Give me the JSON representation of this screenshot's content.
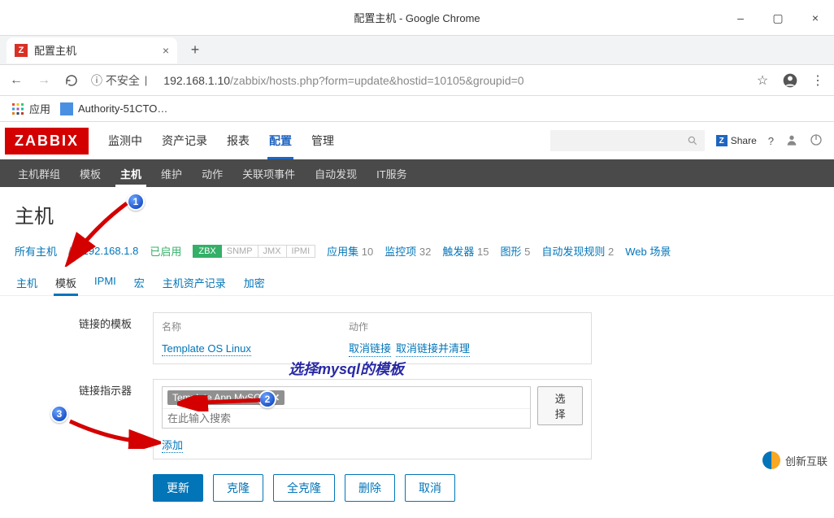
{
  "window": {
    "title": "配置主机 - Google Chrome",
    "controls": {
      "min": "–",
      "max": "▢",
      "close": "×"
    }
  },
  "tab": {
    "favicon_letter": "Z",
    "label": "配置主机",
    "close": "×",
    "new": "+"
  },
  "toolbar": {
    "back": "←",
    "forward": "→",
    "reload_icon": "reload",
    "insecure_prefix": "ⓘ 不安全",
    "sep": "|",
    "url_host": "192.168.1.10",
    "url_path": "/zabbix/hosts.php?form=update&hostid=10105&groupid=0",
    "star_icon": "☆",
    "profile_icon": "●",
    "menu_icon": "⋮"
  },
  "bookmarks": {
    "apps": "应用",
    "item1": "Authority-51CTO…"
  },
  "header": {
    "logo": "ZABBIX",
    "menu": [
      "监测中",
      "资产记录",
      "报表",
      "配置",
      "管理"
    ],
    "menu_active_index": 3,
    "share": "Share",
    "help": "?",
    "user_icon": "user",
    "power_icon": "power"
  },
  "submenu": {
    "items": [
      "主机群组",
      "模板",
      "主机",
      "维护",
      "动作",
      "关联项事件",
      "自动发现",
      "IT服务"
    ],
    "active_index": 2
  },
  "page": {
    "title": "主机"
  },
  "host_info": {
    "all_hosts": "所有主机",
    "sep": "/",
    "ip": "192.168.1.8",
    "enabled": "已启用",
    "protocols": [
      "ZBX",
      "SNMP",
      "JMX",
      "IPMI"
    ],
    "protocol_active_index": 0,
    "metrics": [
      {
        "label": "应用集",
        "n": "10"
      },
      {
        "label": "监控项",
        "n": "32"
      },
      {
        "label": "触发器",
        "n": "15"
      },
      {
        "label": "图形",
        "n": "5"
      },
      {
        "label": "自动发现规则",
        "n": "2"
      },
      {
        "label": "Web 场景",
        "n": ""
      }
    ]
  },
  "tabs": {
    "items": [
      "主机",
      "模板",
      "IPMI",
      "宏",
      "主机资产记录",
      "加密"
    ],
    "active_index": 1
  },
  "form": {
    "linked_label": "链接的模板",
    "name_header": "名称",
    "action_header": "动作",
    "tpl_os": "Template OS Linux",
    "unlink": "取消链接",
    "unlink_clear": "取消链接并清理",
    "linker_label": "链接指示器",
    "tag": "Template App MySQL",
    "tag_x": "✕",
    "search_placeholder": "在此输入搜索",
    "select_btn": "选择",
    "add_link": "添加"
  },
  "buttons": {
    "update": "更新",
    "clone": "克隆",
    "full_clone": "全克隆",
    "delete": "删除",
    "cancel": "取消"
  },
  "annotations": {
    "n1": "1",
    "n2": "2",
    "n3": "3",
    "hint": "选择mysql的模板"
  },
  "watermark": {
    "text": "创新互联"
  }
}
